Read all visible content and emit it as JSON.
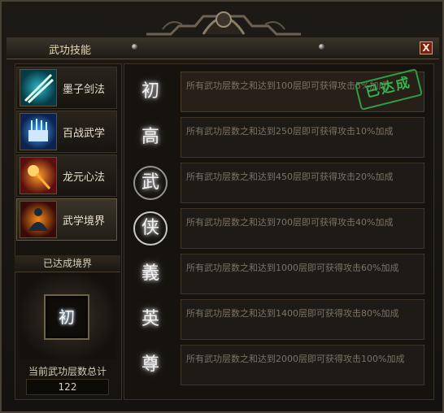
{
  "window": {
    "title": "武功技能",
    "close_label": "X"
  },
  "skills": [
    {
      "label": "墨子剑法",
      "icon": "crossed-swords-icon",
      "selected": false
    },
    {
      "label": "百战武学",
      "icon": "scroll-book-icon",
      "selected": false
    },
    {
      "label": "龙元心法",
      "icon": "dragon-flame-orb-icon",
      "selected": false
    },
    {
      "label": "武学境界",
      "icon": "meditating-warrior-icon",
      "selected": true
    }
  ],
  "realm": {
    "header": "已达成境界",
    "current": "初",
    "total_label": "当前武功层数总计",
    "total_value": "122"
  },
  "tiers": [
    {
      "char": "初",
      "text": "所有武功层数之和达到100层即可获得攻击5%加成",
      "completed": true,
      "stamp": "已达成"
    },
    {
      "char": "高",
      "text": "所有武功层数之和达到250层即可获得攻击10%加成",
      "completed": false
    },
    {
      "char": "武",
      "text": "所有武功层数之和达到450层即可获得攻击20%加成",
      "completed": false
    },
    {
      "char": "侠",
      "text": "所有武功层数之和达到700层即可获得攻击40%加成",
      "completed": false
    },
    {
      "char": "義",
      "text": "所有武功层数之和达到1000层即可获得攻击60%加成",
      "completed": false
    },
    {
      "char": "英",
      "text": "所有武功层数之和达到1400层即可获得攻击80%加成",
      "completed": false
    },
    {
      "char": "尊",
      "text": "所有武功层数之和达到2000层即可获得攻击100%加成",
      "completed": false
    }
  ],
  "colors": {
    "stamp_green": "#35b34d",
    "close_red": "#7a1d14"
  }
}
